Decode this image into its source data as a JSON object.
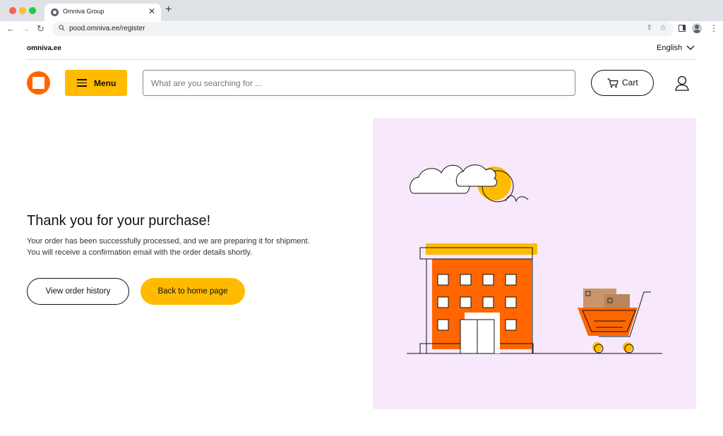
{
  "browser": {
    "tab_title": "Omniva Group",
    "tab_close": "✕",
    "new_tab": "+",
    "nav_back": "←",
    "nav_forward": "→",
    "nav_reload": "↻",
    "url": "pood.omniva.ee/register",
    "share_icon": "⇪",
    "bookmark_icon": "☆",
    "menu_icon": "⋮"
  },
  "topbar": {
    "site_link": "omniva.ee",
    "language": "English"
  },
  "header": {
    "menu_label": "Menu",
    "search_placeholder": "What are you searching for ...",
    "cart_label": "Cart"
  },
  "confirmation": {
    "title": "Thank you for your purchase!",
    "message_line1": "Your order has been successfully processed, and we are preparing it for shipment.",
    "message_line2": "You will receive a confirmation email with the order details shortly.",
    "primary_button": "View order history",
    "secondary_button": "Back to home page"
  },
  "colors": {
    "accent_yellow": "#ffbb00",
    "brand_orange": "#ff6600",
    "illustration_bg": "#f7e9fb"
  }
}
